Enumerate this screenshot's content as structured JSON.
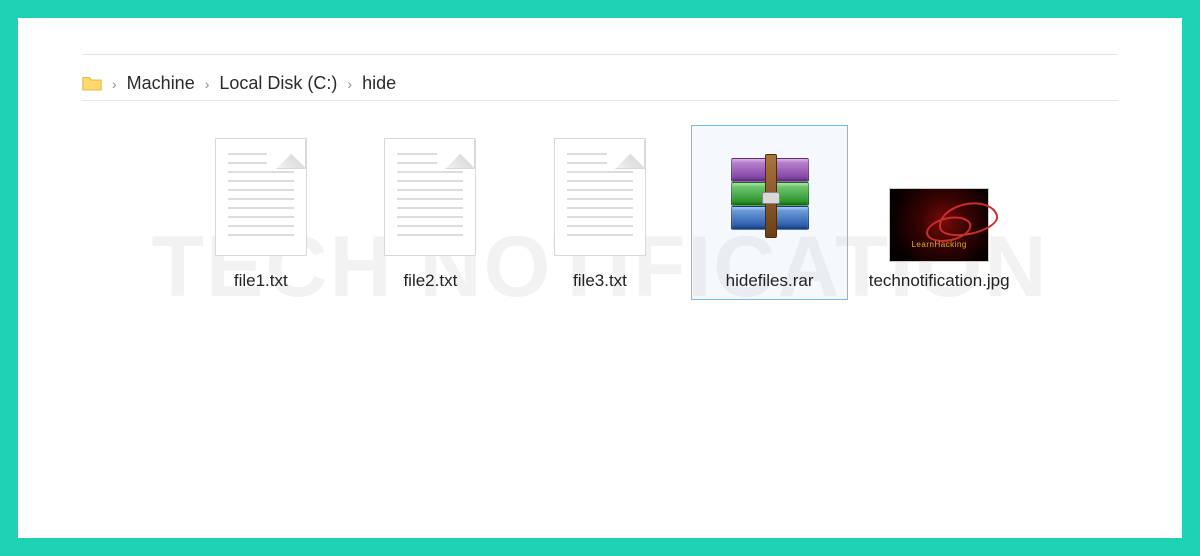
{
  "breadcrumb": {
    "items": [
      "Machine",
      "Local Disk (C:)",
      "hide"
    ]
  },
  "watermark_text": "TECH  NOTIFICATION",
  "files": [
    {
      "name": "file1.txt",
      "type": "txt",
      "selected": false
    },
    {
      "name": "file2.txt",
      "type": "txt",
      "selected": false
    },
    {
      "name": "file3.txt",
      "type": "txt",
      "selected": false
    },
    {
      "name": "hidefiles.rar",
      "type": "rar",
      "selected": true
    },
    {
      "name": "technotification.jpg",
      "type": "jpg",
      "selected": false,
      "caption": "LearnHacking"
    }
  ]
}
